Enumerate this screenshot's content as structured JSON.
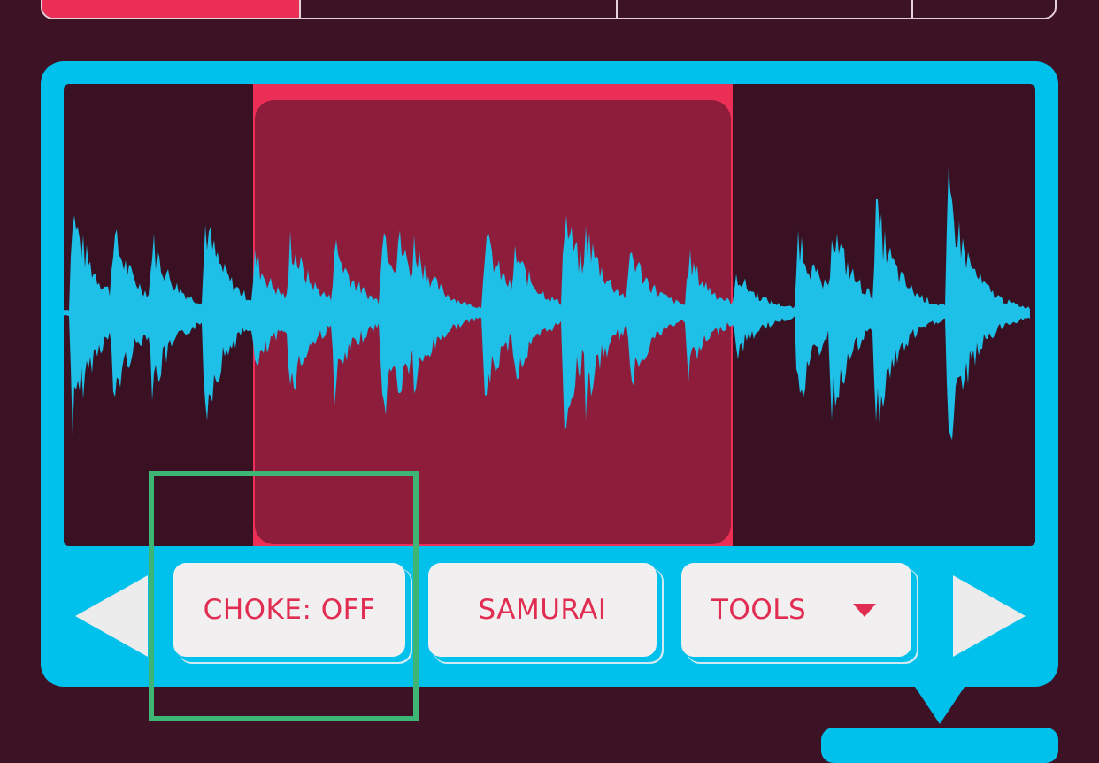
{
  "tabs": {
    "active_color": "#ec2f57"
  },
  "panel": {
    "color": "#00c0ec",
    "screen_color": "#3a1122",
    "waveform_color": "#1ec0e8",
    "selection_color": "#ec2f57"
  },
  "waveform": {
    "selection_start": 0.195,
    "selection_end": 0.689
  },
  "buttons": {
    "choke_label": "CHOKE: OFF",
    "samurai_label": "SAMURAI",
    "tools_label": "TOOLS"
  },
  "icons": {
    "prev": "triangle-left",
    "next": "triangle-right",
    "tools_caret": "triangle-down"
  },
  "highlight_color": "#3db574"
}
